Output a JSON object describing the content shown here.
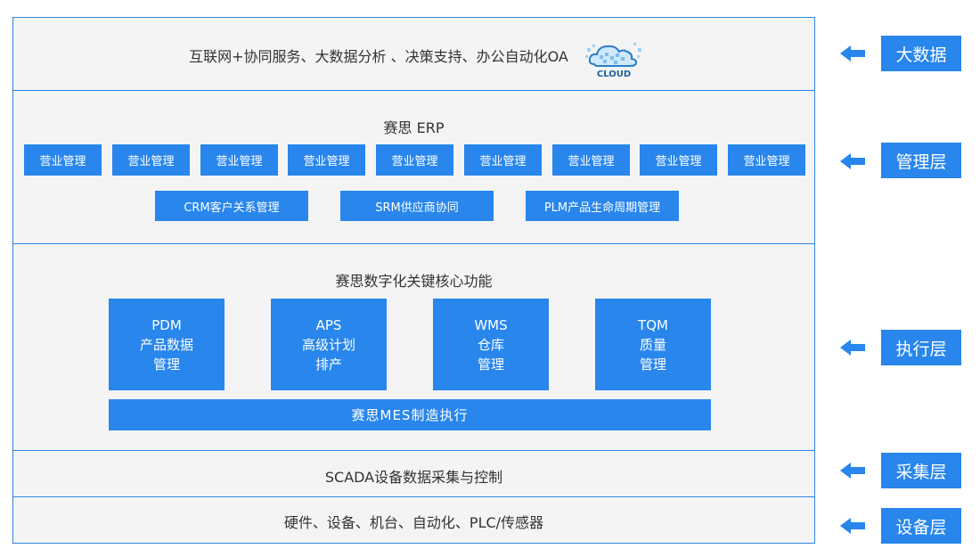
{
  "colors": {
    "accent": "#2886ec",
    "border": "#2b86e3",
    "panel_bg": "#f4f4f4",
    "text": "#333333"
  },
  "layers": {
    "bigdata": {
      "text": "互联网+协同服务、大数据分析 、决策支持、办公自动化OA",
      "cloud_icon_label": "CLOUD"
    },
    "erp": {
      "title": "赛思 ERP",
      "modules": [
        "营业管理",
        "营业管理",
        "营业管理",
        "营业管理",
        "营业管理",
        "营业管理",
        "营业管理",
        "营业管理",
        "营业管理"
      ],
      "sub_modules": [
        "CRM客户关系管理",
        "SRM供应商协同",
        "PLM产品生命周期管理"
      ]
    },
    "core": {
      "title": "赛思数字化关键核心功能",
      "functions": [
        {
          "code": "PDM",
          "line1": "产品数据",
          "line2": "管理"
        },
        {
          "code": "APS",
          "line1": "高级计划",
          "line2": "排产"
        },
        {
          "code": "WMS",
          "line1": "仓库",
          "line2": "管理"
        },
        {
          "code": "TQM",
          "line1": "质量",
          "line2": "管理"
        }
      ],
      "mes": "赛思MES制造执行"
    },
    "scada": {
      "text": "SCADA设备数据采集与控制"
    },
    "device": {
      "text": "硬件、设备、机台、自动化、PLC/传感器"
    }
  },
  "side_labels": [
    "大数据",
    "管理层",
    "执行层",
    "采集层",
    "设备层"
  ],
  "icons": {
    "arrow": "arrow-left-icon",
    "cloud": "cloud-icon"
  }
}
